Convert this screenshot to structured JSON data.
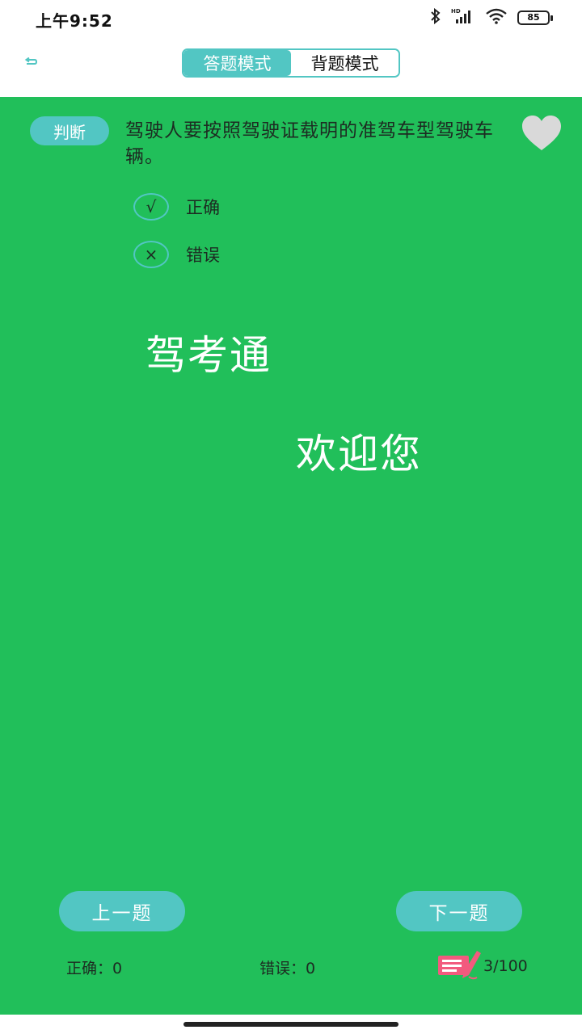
{
  "status_bar": {
    "time": "上午9:52",
    "battery": "85",
    "icons": [
      "bluetooth-icon",
      "signal-hd-icon",
      "wifi-icon",
      "battery-icon"
    ]
  },
  "header": {
    "back_icon": "back-arrow-icon",
    "tabs": [
      {
        "label": "答题模式",
        "active": true
      },
      {
        "label": "背题模式",
        "active": false
      }
    ]
  },
  "question": {
    "type": "判断",
    "text": "驾驶人要按照驾驶证载明的准驾车型驾驶车辆。",
    "favorite_icon": "heart-icon",
    "options": [
      {
        "symbol": "√",
        "label": "正确"
      },
      {
        "symbol": "×",
        "label": "错误"
      }
    ]
  },
  "watermark": {
    "line1": "驾考通",
    "line2": "欢迎您"
  },
  "footer": {
    "prev_label": "上一题",
    "next_label": "下一题",
    "correct": "正确：0",
    "wrong": "错误：0",
    "progress": "3/100",
    "progress_icon": "answer-sheet-icon"
  },
  "colors": {
    "accent": "#52c6c3",
    "background": "#21bf5a",
    "heart": "#d9d9d9",
    "sheet_icon": "#f25a7e"
  }
}
